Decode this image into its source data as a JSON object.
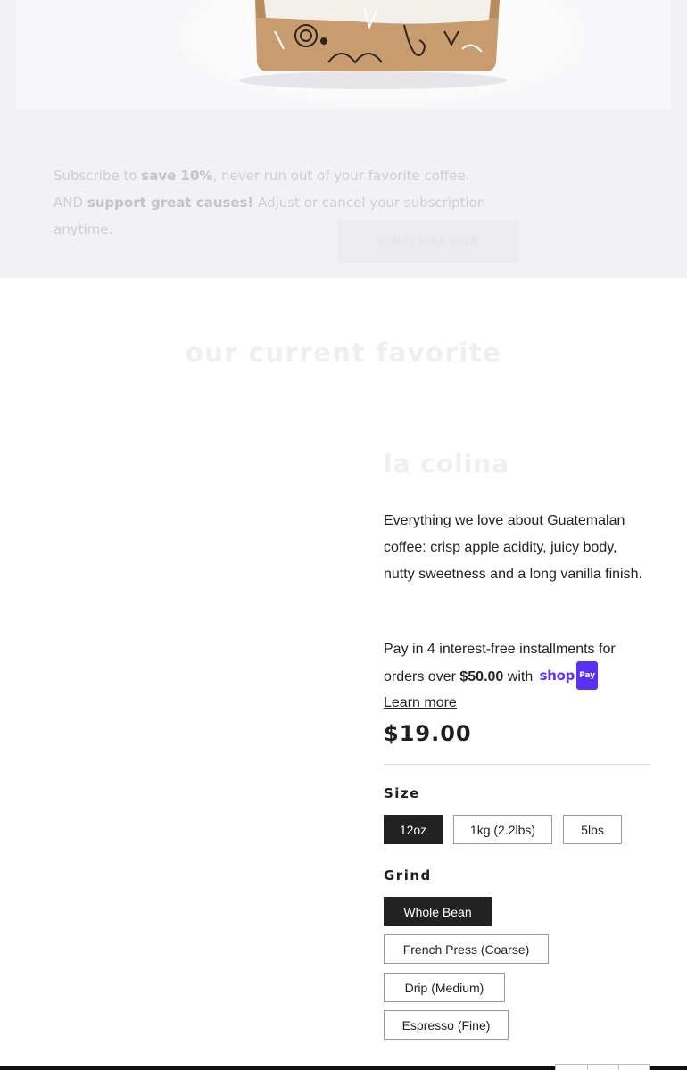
{
  "subscription": {
    "text_prefix": "Subscribe to ",
    "text_bold1": "save 10%",
    "text_middle": ", never run out of your favorite coffee. AND ",
    "text_bold2": "support great causes!",
    "text_suffix": " Adjust or cancel your subscription anytime.",
    "button_label": "subscribe now"
  },
  "section": {
    "title": "our current favorite"
  },
  "product": {
    "name": "la colina",
    "description": "Everything we love about Guatemalan coffee: crisp apple acidity, juicy body, nutty sweetness and a long vanilla finish.",
    "installments_prefix": "Pay in 4 interest-free installments for orders over ",
    "installments_amount": "$50.00",
    "installments_with": " with ",
    "shoppay_word": "shop",
    "shoppay_badge": "Pay",
    "learn_more": "Learn more",
    "price": "$19.00"
  },
  "options": {
    "size": {
      "label": "Size",
      "values": [
        "12oz",
        "1kg (2.2lbs)",
        "5lbs"
      ],
      "selected": "12oz"
    },
    "grind": {
      "label": "Grind",
      "values": [
        "Whole Bean",
        "French Press (Coarse)",
        "Drip (Medium)",
        "Espresso (Fine)"
      ],
      "selected": "Whole Bean"
    }
  },
  "colors": {
    "accent": "#5a31f4",
    "selected_chip": "#222222",
    "band_background": "#f2f2f4"
  }
}
